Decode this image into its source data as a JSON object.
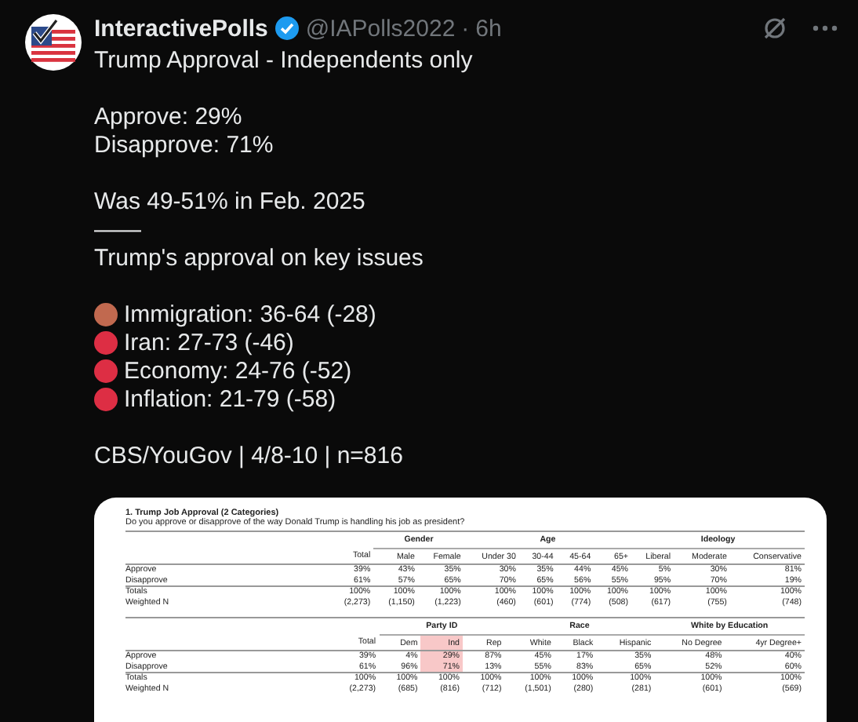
{
  "post": {
    "author": "InteractivePolls",
    "handle": "@IAPolls2022",
    "separator": "·",
    "time": "6h",
    "verified": true
  },
  "body": [
    {
      "lines": [
        {
          "kind": "text",
          "text": "Trump Approval - Independents only"
        }
      ]
    },
    {
      "lines": [
        {
          "kind": "text",
          "text": "Approve: 29%"
        },
        {
          "kind": "text",
          "text": "Disapprove: 71%"
        }
      ]
    },
    {
      "lines": [
        {
          "kind": "text",
          "text": "Was 49-51% in Feb. 2025"
        },
        {
          "kind": "text",
          "text": "——"
        },
        {
          "kind": "text",
          "text": "Trump's approval on key issues"
        }
      ]
    },
    {
      "lines": [
        {
          "kind": "issue",
          "color": "#c1694f",
          "text": "Immigration: 36-64 (-28)"
        },
        {
          "kind": "issue",
          "color": "#dd2e44",
          "text": "Iran: 27-73 (-46)"
        },
        {
          "kind": "issue",
          "color": "#dd2e44",
          "text": "Economy: 24-76 (-52)"
        },
        {
          "kind": "issue",
          "color": "#dd2e44",
          "text": "Inflation: 21-79 (-58)"
        }
      ]
    },
    {
      "lines": [
        {
          "kind": "text",
          "text": "CBS/YouGov | 4/8-10 | n=816"
        }
      ]
    }
  ],
  "document": {
    "title": "1. Trump Job Approval (2 Categories)",
    "question": "Do you approve or disapprove of the way Donald Trump is handling his job as president?",
    "tables": [
      {
        "groups": [
          {
            "columns": [
              {
                "label": "Total",
                "highlighted": false
              }
            ]
          },
          {
            "label": "Gender",
            "columns": [
              {
                "label": "Male",
                "highlighted": false
              },
              {
                "label": "Female",
                "highlighted": false
              }
            ]
          },
          {
            "label": "Age",
            "columns": [
              {
                "label": "Under 30",
                "highlighted": false
              },
              {
                "label": "30-44",
                "highlighted": false
              },
              {
                "label": "45-64",
                "highlighted": false
              },
              {
                "label": "65+",
                "highlighted": false
              }
            ]
          },
          {
            "label": "Ideology",
            "columns": [
              {
                "label": "Liberal",
                "highlighted": false
              },
              {
                "label": "Moderate",
                "highlighted": false
              },
              {
                "label": "Conservative",
                "highlighted": false
              }
            ]
          }
        ],
        "rows": [
          {
            "kind": "data",
            "label": "Approve",
            "cells": [
              "39%",
              "43%",
              "35%",
              "30%",
              "35%",
              "44%",
              "45%",
              "5%",
              "30%",
              "81%"
            ]
          },
          {
            "kind": "data",
            "label": "Disapprove",
            "cells": [
              "61%",
              "57%",
              "65%",
              "70%",
              "65%",
              "56%",
              "55%",
              "95%",
              "70%",
              "19%"
            ]
          },
          {
            "kind": "total",
            "label": "Totals",
            "cells": [
              "100%",
              "100%",
              "100%",
              "100%",
              "100%",
              "100%",
              "100%",
              "100%",
              "100%",
              "100%"
            ]
          },
          {
            "kind": "data",
            "label": "Weighted N",
            "cells": [
              "(2,273)",
              "(1,150)",
              "(1,223)",
              "(460)",
              "(601)",
              "(774)",
              "(508)",
              "(617)",
              "(755)",
              "(748)"
            ]
          }
        ]
      },
      {
        "groups": [
          {
            "columns": [
              {
                "label": "Total",
                "highlighted": false
              }
            ]
          },
          {
            "label": "Party ID",
            "columns": [
              {
                "label": "Dem",
                "highlighted": false
              },
              {
                "label": "Ind",
                "highlighted": true
              },
              {
                "label": "Rep",
                "highlighted": false
              }
            ]
          },
          {
            "label": "Race",
            "columns": [
              {
                "label": "White",
                "highlighted": false
              },
              {
                "label": "Black",
                "highlighted": false
              },
              {
                "label": "Hispanic",
                "highlighted": false
              }
            ]
          },
          {
            "label": "White by Education",
            "columns": [
              {
                "label": "No Degree",
                "highlighted": false
              },
              {
                "label": "4yr Degree+",
                "highlighted": false
              }
            ]
          }
        ],
        "rows": [
          {
            "kind": "data",
            "label": "Approve",
            "cells": [
              "39%",
              "4%",
              "29%",
              "87%",
              "45%",
              "17%",
              "35%",
              "48%",
              "40%"
            ]
          },
          {
            "kind": "data",
            "label": "Disapprove",
            "cells": [
              "61%",
              "96%",
              "71%",
              "13%",
              "55%",
              "83%",
              "65%",
              "52%",
              "60%"
            ]
          },
          {
            "kind": "total",
            "label": "Totals",
            "cells": [
              "100%",
              "100%",
              "100%",
              "100%",
              "100%",
              "100%",
              "100%",
              "100%",
              "100%"
            ]
          },
          {
            "kind": "data",
            "label": "Weighted N",
            "cells": [
              "(2,273)",
              "(685)",
              "(816)",
              "(712)",
              "(1,501)",
              "(280)",
              "(281)",
              "(601)",
              "(569)"
            ]
          }
        ]
      }
    ]
  }
}
